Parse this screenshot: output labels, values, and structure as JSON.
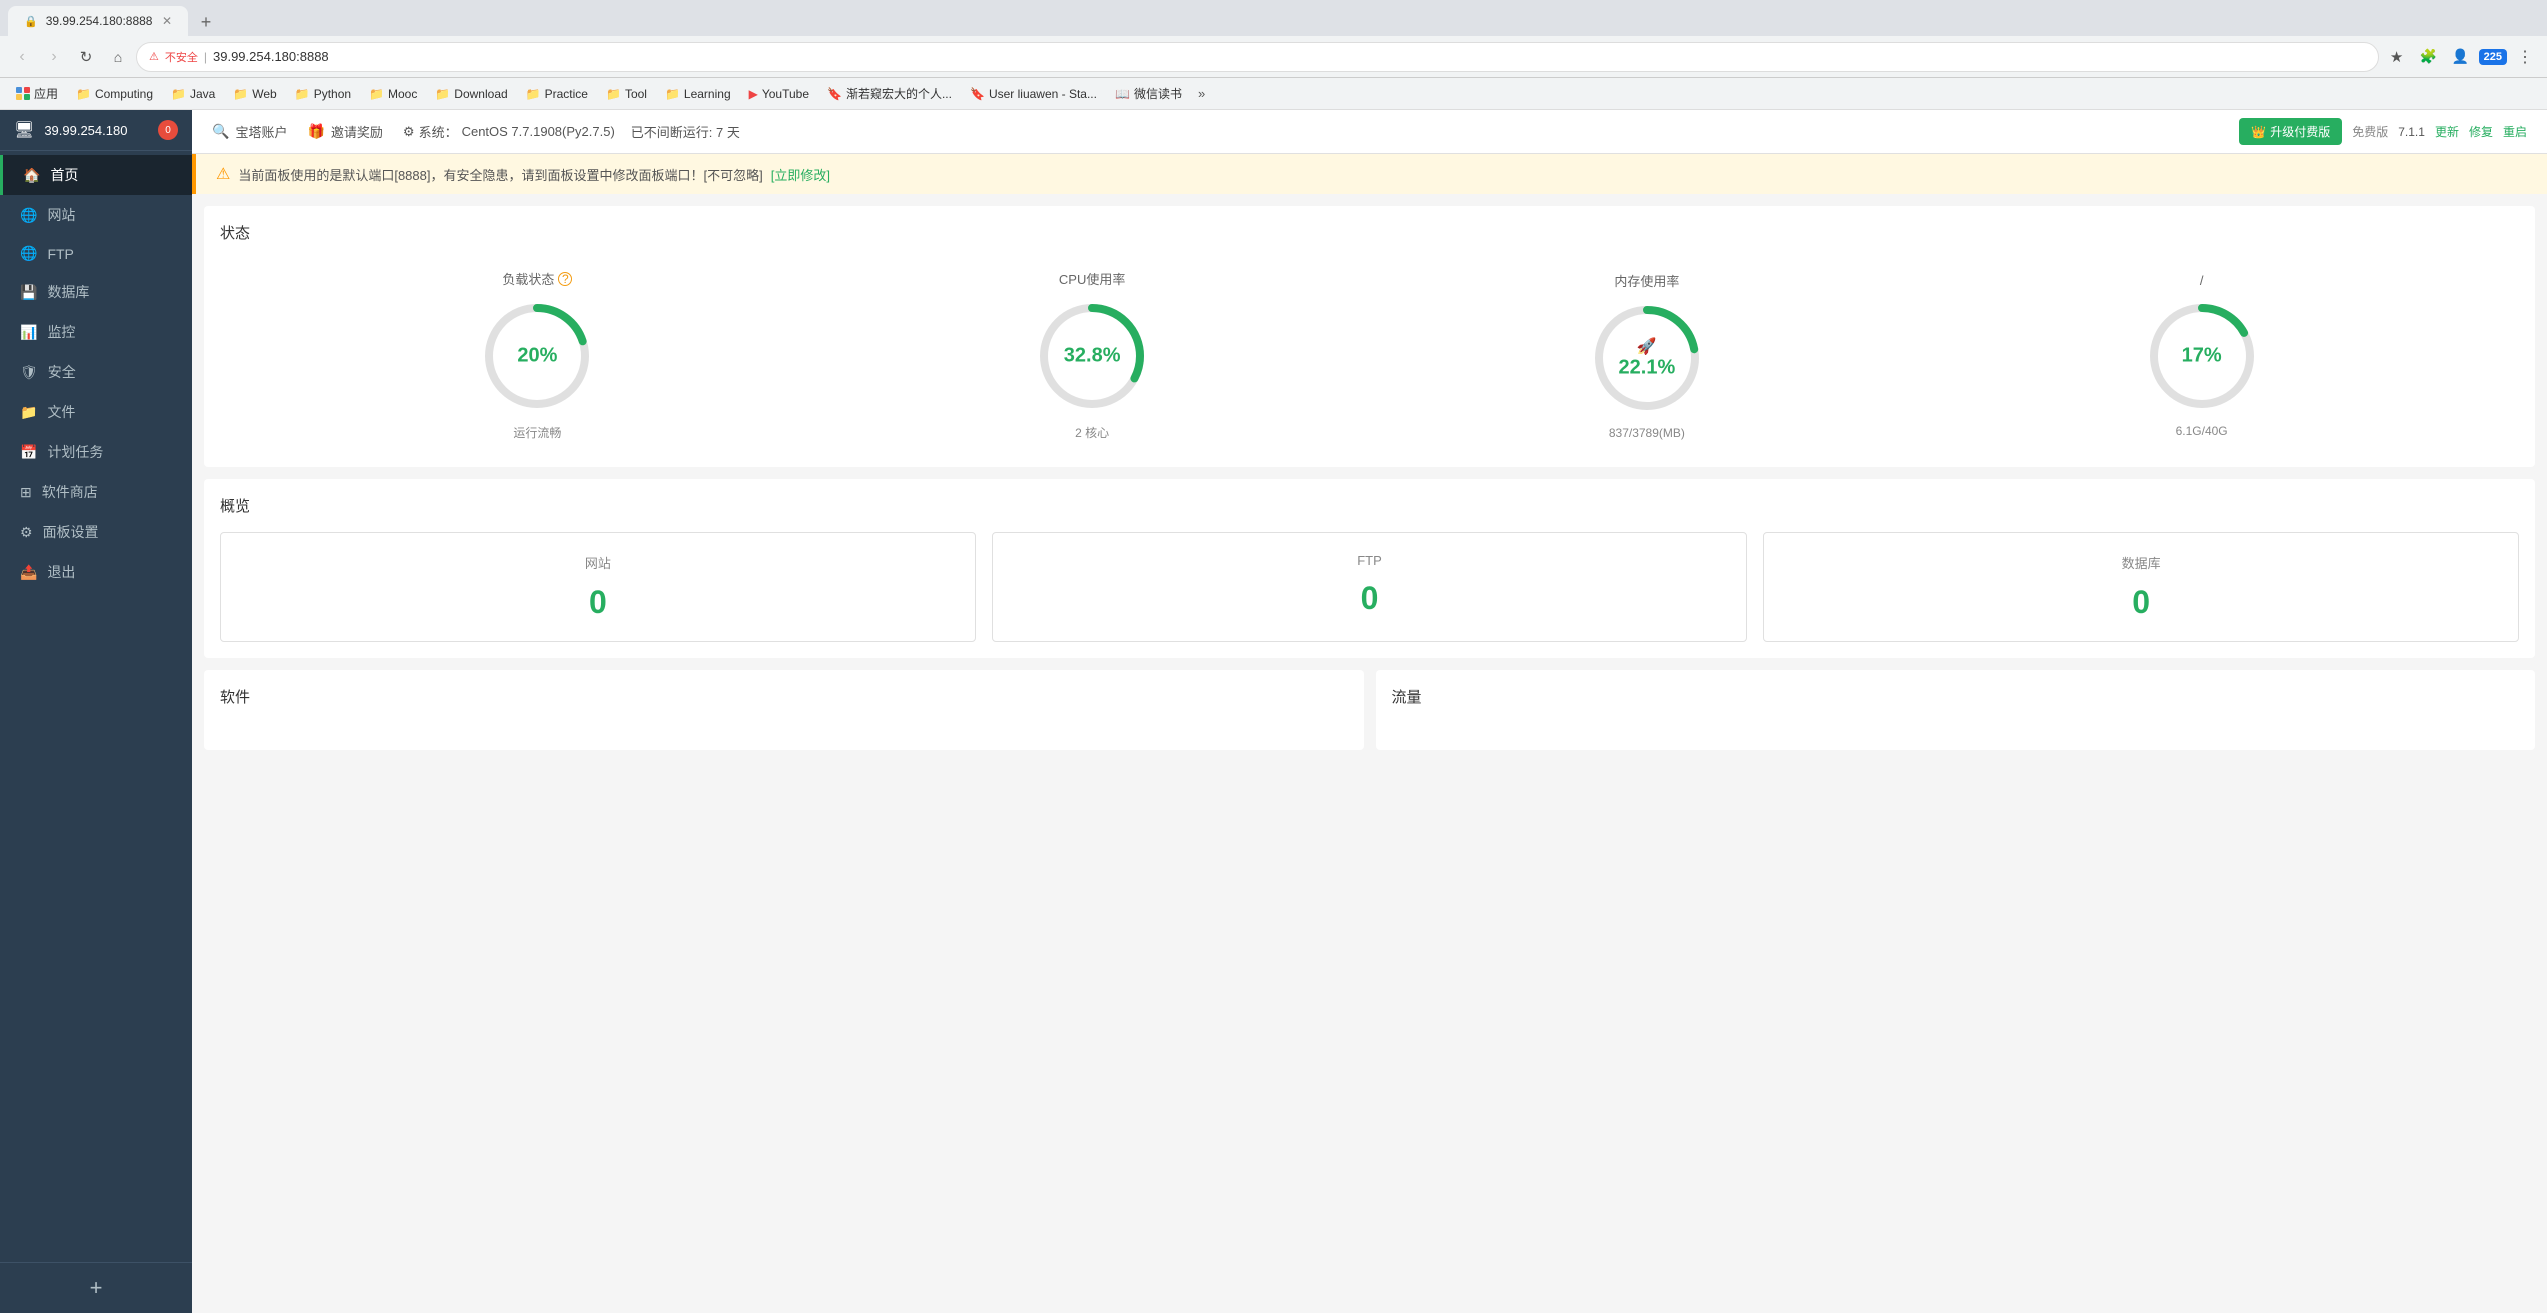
{
  "browser": {
    "tab_title": "39.99.254.180:8888",
    "address": "39.99.254.180:8888",
    "address_prefix": "不安全",
    "bookmarks": [
      {
        "label": "应用",
        "icon": "grid",
        "color": "blue"
      },
      {
        "label": "Computing",
        "icon": "folder",
        "color": "yellow"
      },
      {
        "label": "Java",
        "icon": "folder",
        "color": "yellow"
      },
      {
        "label": "Web",
        "icon": "folder",
        "color": "yellow"
      },
      {
        "label": "Python",
        "icon": "folder",
        "color": "yellow"
      },
      {
        "label": "Mooc",
        "icon": "folder",
        "color": "yellow"
      },
      {
        "label": "Download",
        "icon": "folder",
        "color": "yellow"
      },
      {
        "label": "Practice",
        "icon": "folder",
        "color": "yellow"
      },
      {
        "label": "Tool",
        "icon": "folder",
        "color": "yellow"
      },
      {
        "label": "Learning",
        "icon": "folder",
        "color": "yellow"
      },
      {
        "label": "YouTube",
        "icon": "youtube",
        "color": "red"
      },
      {
        "label": "渐若窥宏大的个人...",
        "icon": "bookmark",
        "color": "blue"
      },
      {
        "label": "User liuawen - Sta...",
        "icon": "bookmark",
        "color": "blue"
      },
      {
        "label": "微信读书",
        "icon": "bookmark",
        "color": "blue"
      }
    ]
  },
  "sidebar": {
    "ip": "39.99.254.180",
    "badge": "0",
    "items": [
      {
        "label": "首页",
        "icon": "🏠",
        "active": true
      },
      {
        "label": "网站",
        "icon": "🌐",
        "active": false
      },
      {
        "label": "FTP",
        "icon": "🌐",
        "active": false
      },
      {
        "label": "数据库",
        "icon": "💾",
        "active": false
      },
      {
        "label": "监控",
        "icon": "📊",
        "active": false
      },
      {
        "label": "安全",
        "icon": "🛡",
        "active": false
      },
      {
        "label": "文件",
        "icon": "📁",
        "active": false
      },
      {
        "label": "计划任务",
        "icon": "📅",
        "active": false
      },
      {
        "label": "软件商店",
        "icon": "⚙",
        "active": false
      },
      {
        "label": "面板设置",
        "icon": "⚙",
        "active": false
      },
      {
        "label": "退出",
        "icon": "📤",
        "active": false
      }
    ],
    "add_label": "+"
  },
  "topbar": {
    "account_label": "宝塔账户",
    "invite_label": "邀请奖励",
    "system_label": "系统：",
    "system_value": "CentOS 7.7.1908(Py2.7.5)",
    "uptime_label": "已不间断运行: 7 天",
    "upgrade_label": "升级付费版",
    "free_label": "免费版",
    "version": "7.1.1",
    "update_label": "更新",
    "restore_label": "修复",
    "restart_label": "重启"
  },
  "warning": {
    "text": "当前面板使用的是默认端口[8888]，有安全隐患，请到面板设置中修改面板端口！[不可忽略]",
    "link_label": "[立即修改]"
  },
  "status": {
    "section_title": "状态",
    "gauges": [
      {
        "label": "负载状态",
        "has_info": true,
        "percent": 20,
        "percent_text": "20%",
        "sub_label": "运行流畅",
        "color": "#27ae60",
        "stroke_dash": "75.4",
        "stroke_gap": "301.6"
      },
      {
        "label": "CPU使用率",
        "has_info": false,
        "percent": 32.8,
        "percent_text": "32.8%",
        "sub_label": "2 核心",
        "color": "#27ae60",
        "stroke_dash": "123.9",
        "stroke_gap": "253.1"
      },
      {
        "label": "内存使用率",
        "has_info": false,
        "percent": 22.1,
        "percent_text": "22.1%",
        "sub_label": "837/3789(MB)",
        "color": "#27ae60",
        "has_icon": true,
        "stroke_dash": "83.5",
        "stroke_gap": "293.5"
      },
      {
        "label": "/",
        "has_info": false,
        "percent": 17,
        "percent_text": "17%",
        "sub_label": "6.1G/40G",
        "color": "#27ae60",
        "stroke_dash": "64.2",
        "stroke_gap": "312.8"
      }
    ]
  },
  "overview": {
    "section_title": "概览",
    "cards": [
      {
        "label": "网站",
        "value": "0"
      },
      {
        "label": "FTP",
        "value": "0"
      },
      {
        "label": "数据库",
        "value": "0"
      }
    ]
  },
  "software_section": {
    "title": "软件"
  },
  "traffic_section": {
    "title": "流量"
  }
}
